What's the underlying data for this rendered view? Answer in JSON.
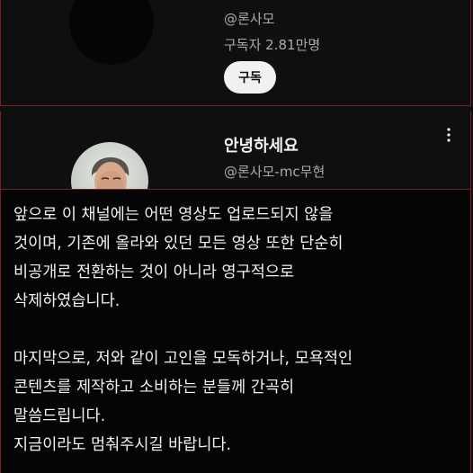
{
  "channel": {
    "handle": "@론사모",
    "subscribers": "구독자 2.81만명",
    "subscribe_label": "구독"
  },
  "post": {
    "title": "안녕하세요",
    "handle": "@론사모-mc무현",
    "more_icon": "more-vertical-icon"
  },
  "message": {
    "paragraph1": [
      "앞으로 이 채널에는 어떤 영상도 업로드되지 않을",
      "것이며, 기존에 올라와 있던 모든 영상 또한 단순히",
      "비공개로 전환하는 것이 아니라 영구적으로",
      "삭제하였습니다."
    ],
    "paragraph2": [
      "마지막으로, 저와 같이 고인을 모독하거나, 모욕적인",
      "콘텐츠를 제작하고 소비하는 분들께 간곡히",
      "말씀드립니다.",
      "지금이라도 멈춰주시길 바랍니다."
    ]
  },
  "colors": {
    "background": "#0f0f0f",
    "frame_border": "#7a1f24",
    "secondary_text": "#aaaaaa",
    "button_bg": "#f1f1f1"
  }
}
